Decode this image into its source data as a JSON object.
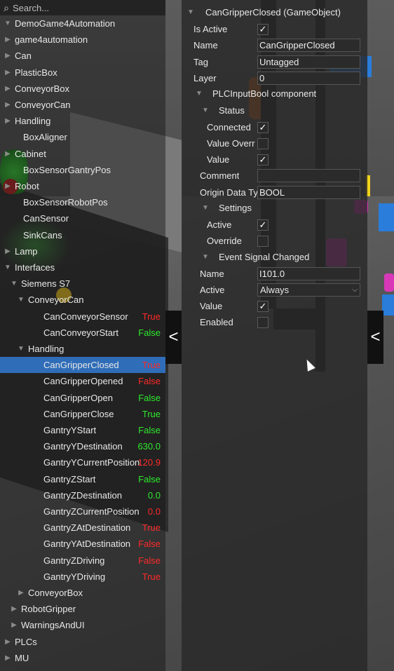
{
  "search": {
    "placeholder": "Search..."
  },
  "hierarchy": {
    "rows": [
      {
        "label": "DemoGame4Automation",
        "indent": 0,
        "tri": "▼",
        "value": "",
        "vclass": ""
      },
      {
        "label": "game4automation",
        "indent": 1,
        "tri": "▶",
        "value": "",
        "vclass": ""
      },
      {
        "label": "Can",
        "indent": 1,
        "tri": "▶",
        "value": "",
        "vclass": ""
      },
      {
        "label": "PlasticBox",
        "indent": 1,
        "tri": "▶",
        "value": "",
        "vclass": ""
      },
      {
        "label": "ConveyorBox",
        "indent": 1,
        "tri": "▶",
        "value": "",
        "vclass": ""
      },
      {
        "label": "ConveyorCan",
        "indent": 1,
        "tri": "▶",
        "value": "",
        "vclass": ""
      },
      {
        "label": "Handling",
        "indent": 1,
        "tri": "▶",
        "value": "",
        "vclass": ""
      },
      {
        "label": "BoxAligner",
        "indent": 1,
        "tri": "",
        "value": "",
        "vclass": ""
      },
      {
        "label": "Cabinet",
        "indent": 1,
        "tri": "▶",
        "value": "",
        "vclass": ""
      },
      {
        "label": "BoxSensorGantryPos",
        "indent": 1,
        "tri": "",
        "value": "",
        "vclass": ""
      },
      {
        "label": "Robot",
        "indent": 1,
        "tri": "▶",
        "value": "",
        "vclass": ""
      },
      {
        "label": "BoxSensorRobotPos",
        "indent": 1,
        "tri": "",
        "value": "",
        "vclass": ""
      },
      {
        "label": "CanSensor",
        "indent": 1,
        "tri": "",
        "value": "",
        "vclass": ""
      },
      {
        "label": "SinkCans",
        "indent": 1,
        "tri": "",
        "value": "",
        "vclass": ""
      },
      {
        "label": "Lamp",
        "indent": 1,
        "tri": "▶",
        "value": "",
        "vclass": ""
      },
      {
        "label": "Interfaces",
        "indent": 1,
        "tri": "▼",
        "value": "",
        "vclass": ""
      },
      {
        "label": "Siemens S7",
        "indent": 2,
        "tri": "▼",
        "value": "",
        "vclass": ""
      },
      {
        "label": "ConveyorCan",
        "indent": 3,
        "tri": "▼",
        "value": "",
        "vclass": ""
      },
      {
        "label": "CanConveyorSensor",
        "indent": 4,
        "tri": "",
        "value": "True",
        "vclass": "v-red"
      },
      {
        "label": "CanConveyorStart",
        "indent": 4,
        "tri": "",
        "value": "False",
        "vclass": "v-green"
      },
      {
        "label": "Handling",
        "indent": 3,
        "tri": "▼",
        "value": "",
        "vclass": ""
      },
      {
        "label": "CanGripperClosed",
        "indent": 4,
        "tri": "",
        "value": "True",
        "vclass": "v-red",
        "selected": true
      },
      {
        "label": "CanGripperOpened",
        "indent": 4,
        "tri": "",
        "value": "False",
        "vclass": "v-red"
      },
      {
        "label": "CanGripperOpen",
        "indent": 4,
        "tri": "",
        "value": "False",
        "vclass": "v-green"
      },
      {
        "label": "CanGripperClose",
        "indent": 4,
        "tri": "",
        "value": "True",
        "vclass": "v-green"
      },
      {
        "label": "GantryYStart",
        "indent": 4,
        "tri": "",
        "value": "False",
        "vclass": "v-green"
      },
      {
        "label": "GantryYDestination",
        "indent": 4,
        "tri": "",
        "value": "630.0",
        "vclass": "v-green"
      },
      {
        "label": "GantryYCurrentPosition",
        "indent": 4,
        "tri": "",
        "value": "120.9",
        "vclass": "v-red"
      },
      {
        "label": "GantryZStart",
        "indent": 4,
        "tri": "",
        "value": "False",
        "vclass": "v-green"
      },
      {
        "label": "GantryZDestination",
        "indent": 4,
        "tri": "",
        "value": "0.0",
        "vclass": "v-green"
      },
      {
        "label": "GantryZCurrentPosition",
        "indent": 4,
        "tri": "",
        "value": "0.0",
        "vclass": "v-red"
      },
      {
        "label": "GantryZAtDestination",
        "indent": 4,
        "tri": "",
        "value": "True",
        "vclass": "v-red"
      },
      {
        "label": "GantryYAtDestination",
        "indent": 4,
        "tri": "",
        "value": "False",
        "vclass": "v-red"
      },
      {
        "label": "GantryZDriving",
        "indent": 4,
        "tri": "",
        "value": "False",
        "vclass": "v-red"
      },
      {
        "label": "GantryYDriving",
        "indent": 4,
        "tri": "",
        "value": "True",
        "vclass": "v-red"
      },
      {
        "label": "ConveyorBox",
        "indent": 3,
        "tri": "▶",
        "value": "",
        "vclass": ""
      },
      {
        "label": "RobotGripper",
        "indent": 2,
        "tri": "▶",
        "value": "",
        "vclass": ""
      },
      {
        "label": "WarningsAndUI",
        "indent": 2,
        "tri": "▶",
        "value": "",
        "vclass": ""
      },
      {
        "label": "PLCs",
        "indent": 1,
        "tri": "▶",
        "value": "",
        "vclass": ""
      },
      {
        "label": "MU",
        "indent": 1,
        "tri": "▶",
        "value": "",
        "vclass": ""
      }
    ]
  },
  "inspector": {
    "title": "CanGripperClosed (GameObject)",
    "is_active_label": "Is  Active",
    "name_label": "Name",
    "name_value": "CanGripperClosed",
    "tag_label": "Tag",
    "tag_value": "Untagged",
    "layer_label": "Layer",
    "layer_value": "0",
    "component_title": "PLCInputBool component",
    "status_title": "Status",
    "connected_label": "Connected",
    "value_override_label": "Value Overr",
    "value_label": "Value",
    "comment_label": "Comment",
    "comment_value": "",
    "origin_label": "Origin Data Ty",
    "origin_value": "BOOL",
    "settings_title": "Settings",
    "active_label": "Active",
    "override_label": "Override",
    "event_title": "Event Signal Changed",
    "event_name_label": "Name",
    "event_name_value": "I101.0",
    "event_active_label": "Active",
    "event_active_value": "Always",
    "event_value_label": "Value",
    "event_enabled_label": "Enabled",
    "check_mark": "✓",
    "collapse_glyph": "<"
  }
}
